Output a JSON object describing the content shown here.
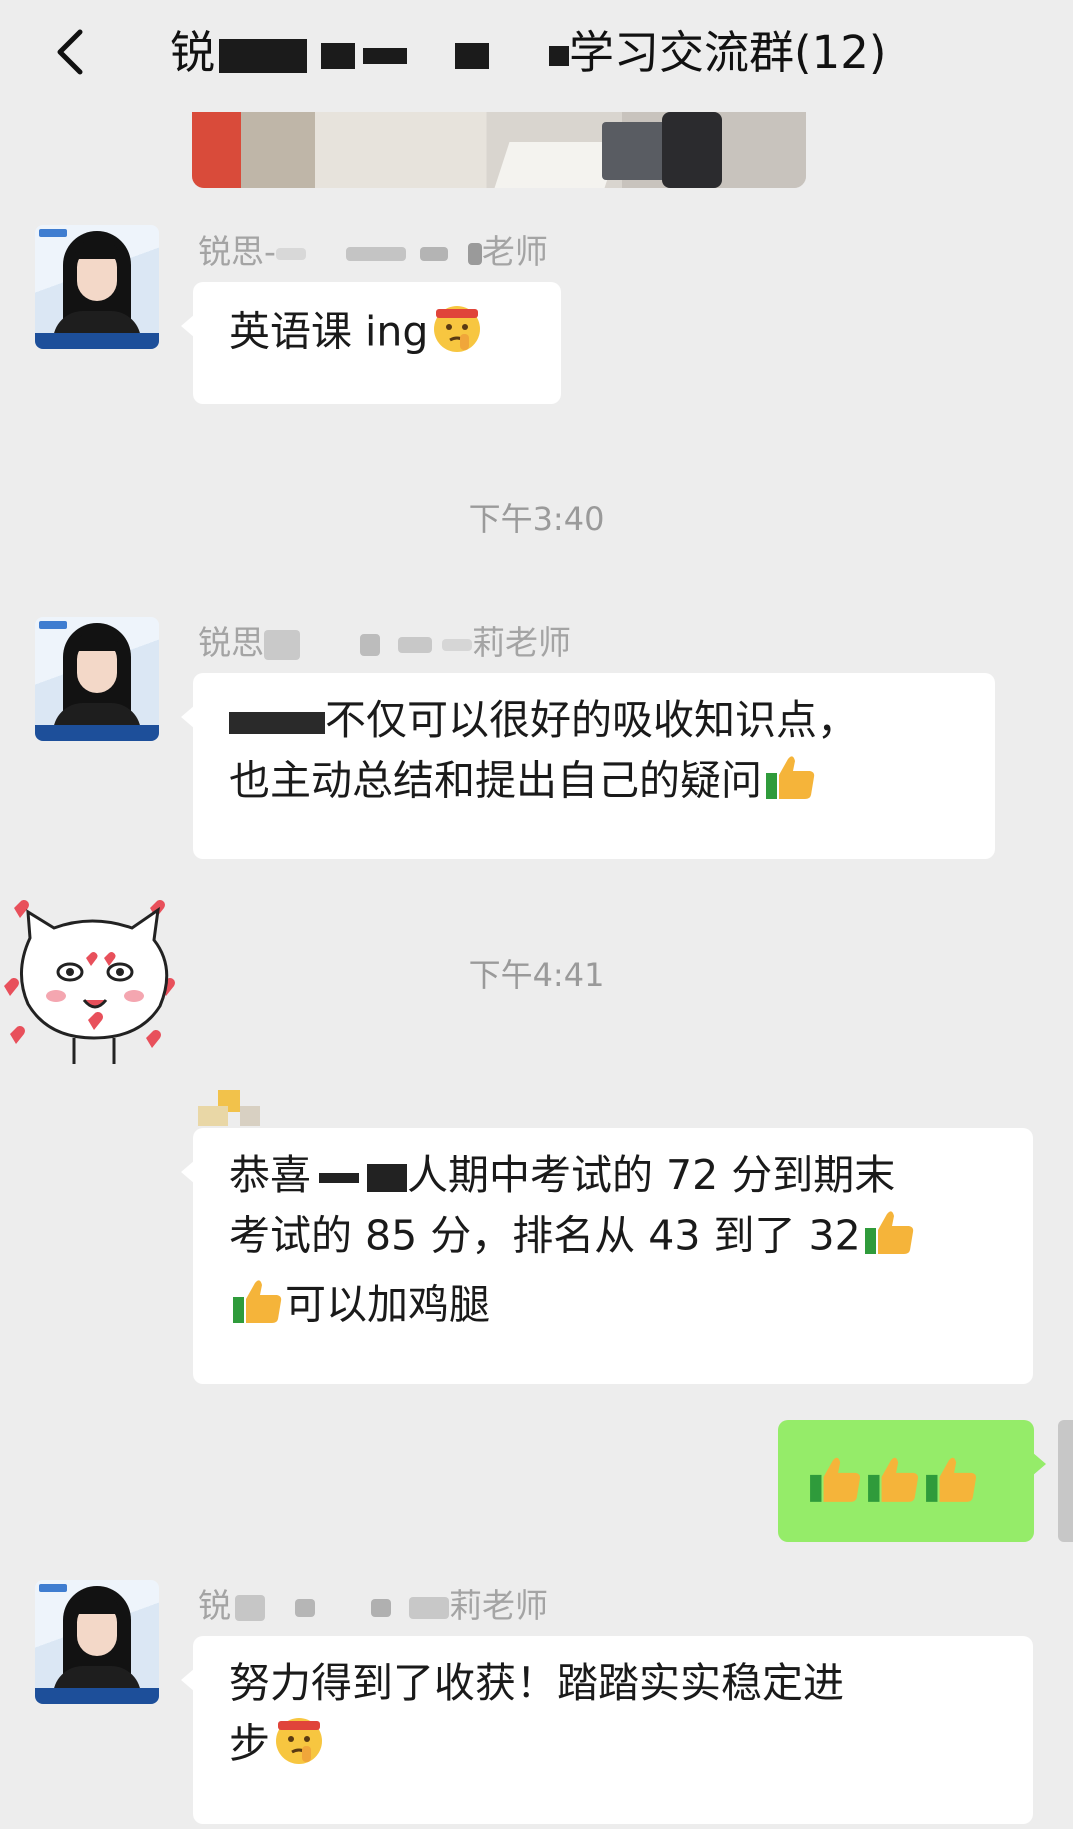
{
  "header": {
    "back_label": "back",
    "title_prefix": "锐",
    "title_suffix": "学习交流群(12)"
  },
  "messages": [
    {
      "sender_prefix": "锐思-",
      "sender_suffix": "老师",
      "text": "英语课 ing"
    },
    {
      "time": "下午3:40"
    },
    {
      "sender_prefix": "锐思",
      "sender_suffix": "莉老师",
      "line1": "不仅可以很好的吸收知识点，",
      "line2": "也主动总结和提出自己的疑问"
    },
    {
      "time": "下午4:41"
    },
    {
      "line1_a": "恭喜",
      "line1_b": "人期中考试的 72 分到期末",
      "line2": "考试的 85 分，排名从 43 到了 32",
      "line3": "可以加鸡腿"
    },
    {
      "mine": true,
      "emoji": [
        "thumbs-up",
        "thumbs-up",
        "thumbs-up"
      ]
    },
    {
      "sender_prefix": "锐",
      "sender_suffix": "莉老师",
      "line1": "努力得到了收获！踏踏实实稳定进",
      "line2": "步"
    }
  ],
  "colors": {
    "background": "#ededed",
    "bubble_incoming": "#ffffff",
    "bubble_outgoing": "#95ec69",
    "sender_text": "#a4a4a4",
    "time_text": "#9a9a9a"
  }
}
